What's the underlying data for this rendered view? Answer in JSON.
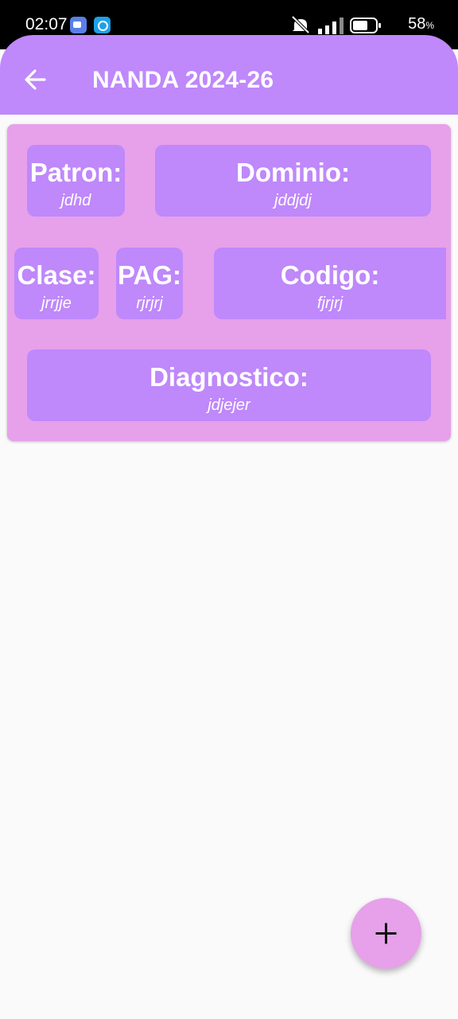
{
  "status_bar": {
    "time": "02:07",
    "battery_percent": "58",
    "battery_unit": "%",
    "icons": [
      "video-app-icon",
      "shield-app-icon",
      "muted-icon",
      "signal-icon",
      "battery-icon"
    ]
  },
  "app_bar": {
    "title": "NANDA 2024-26",
    "back_icon": "arrow-left-icon"
  },
  "record": {
    "patron": {
      "label": "Patron:",
      "value": "jdhd"
    },
    "dominio": {
      "label": "Dominio:",
      "value": "jddjdj"
    },
    "clase": {
      "label": "Clase:",
      "value": "jrrjje"
    },
    "pag": {
      "label": "PAG:",
      "value": "rjrjrj"
    },
    "codigo": {
      "label": "Codigo:",
      "value": "fjrjrj"
    },
    "diagnostico": {
      "label": "Diagnostico:",
      "value": "jdjejer"
    }
  },
  "fab": {
    "icon": "plus-icon"
  },
  "colors": {
    "app_bar": "#bf88fb",
    "card": "#e7a0ea",
    "chip": "#bf88fb",
    "background": "#fafafa"
  }
}
